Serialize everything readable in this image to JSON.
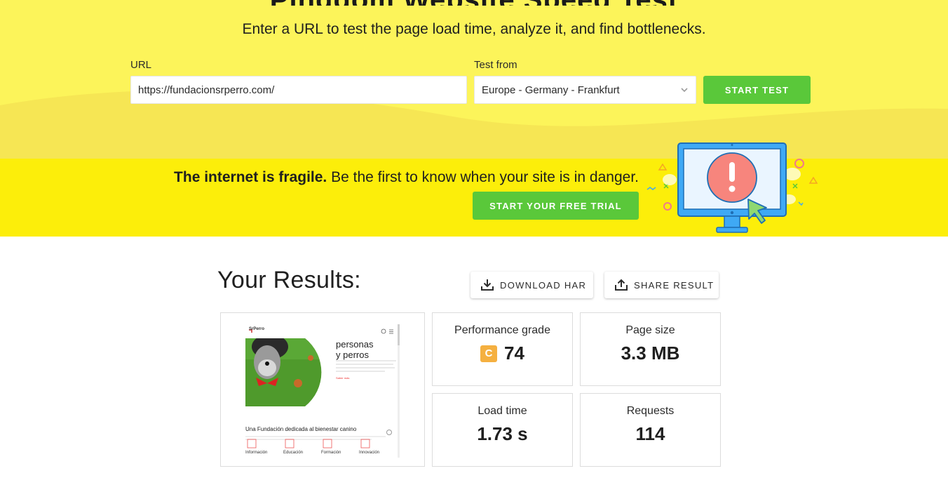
{
  "hero": {
    "title_partial": "Pingdom Website Speed Test",
    "subtitle": "Enter a URL to test the page load time, analyze it, and find bottlenecks.",
    "url_label": "URL",
    "url_value": "https://fundacionsrperro.com/",
    "test_from_label": "Test from",
    "test_from_value": "Europe - Germany - Frankfurt",
    "start_button": "START TEST"
  },
  "banner": {
    "bold_text": "The internet is fragile.",
    "text": " Be the first to know when your site is in danger.",
    "cta": "START YOUR FREE TRIAL"
  },
  "results": {
    "title": "Your Results:",
    "download_har": "DOWNLOAD HAR",
    "share_result": "SHARE RESULT",
    "performance": {
      "label": "Performance grade",
      "grade": "C",
      "value": "74"
    },
    "page_size": {
      "label": "Page size",
      "value": "3.3 MB"
    },
    "load_time": {
      "label": "Load time",
      "value": "1.73 s"
    },
    "requests": {
      "label": "Requests",
      "value": "114"
    }
  },
  "screenshot": {
    "logo": "SrPerro",
    "headline_line1": "personas",
    "headline_line2": "y perros",
    "link": "Saber más",
    "tagline": "Una Fundación dedicada al bienestar canino",
    "categories": [
      "Información",
      "Educación",
      "Formación",
      "Innovación"
    ]
  },
  "colors": {
    "hero_bg": "#fcf45a",
    "banner_bg": "#fcee0a",
    "button_green": "#5ac83a",
    "grade_c": "#f5b040"
  },
  "icons": [
    "chevron-down-icon",
    "download-icon",
    "share-icon",
    "monitor-alert-icon",
    "cursor-icon"
  ]
}
